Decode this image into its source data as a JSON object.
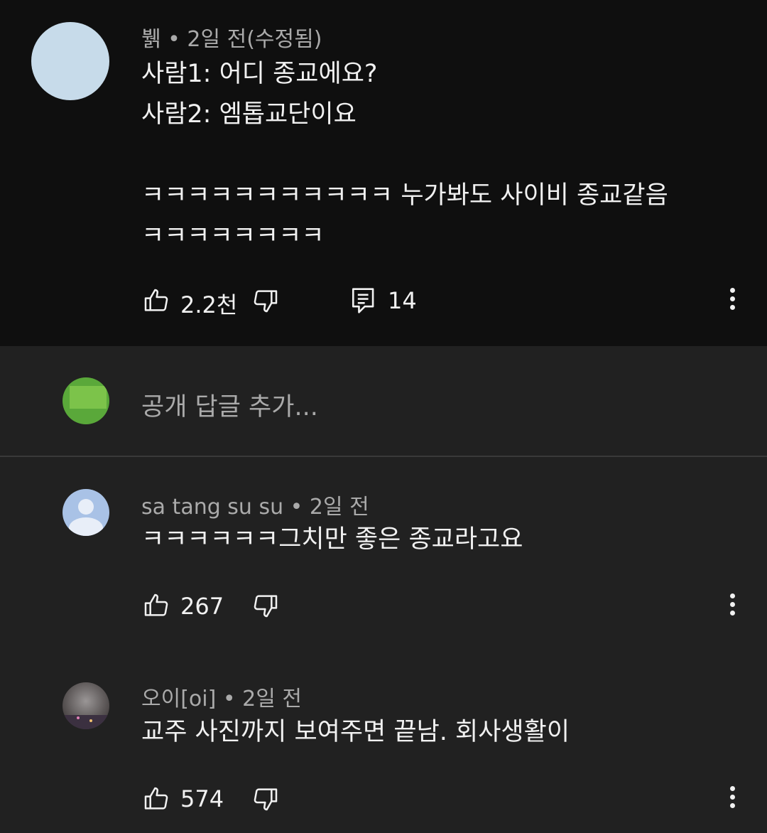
{
  "comments": [
    {
      "author": "뷁",
      "time": "2일 전(수정됨)",
      "lines": [
        "사람1: 어디 종교에요?",
        "사람2: 엠톱교단이요",
        "",
        "ㅋㅋㅋㅋㅋㅋㅋㅋㅋㅋㅋ 누가봐도 사이비 종교같음",
        "ㅋㅋㅋㅋㅋㅋㅋㅋ"
      ],
      "likes": "2.2천",
      "replies": "14",
      "avatar_color": "#c7dbea"
    },
    {
      "author": "sa tang su su",
      "time": "2일 전",
      "lines": [
        "ㅋㅋㅋㅋㅋㅋ그치만 좋은 종교라고요"
      ],
      "likes": "267",
      "avatar_color": "#a9c2e6"
    },
    {
      "author": "오이[oi]",
      "time": "2일 전",
      "lines": [
        "교주 사진까지 보여주면 끝남. 회사생활이"
      ],
      "likes": "574",
      "avatar_color": "#5b5656"
    }
  ],
  "reply_input": {
    "placeholder": "공개 답글 추가..."
  },
  "separator": "•",
  "icons": [
    "thumbs-up-icon",
    "thumbs-down-icon",
    "reply-icon",
    "more-icon"
  ],
  "colors": {
    "dark_bg": "#0f0f0f",
    "bg": "#212121",
    "muted": "#aaaaaa",
    "text": "#f1f1f1"
  }
}
